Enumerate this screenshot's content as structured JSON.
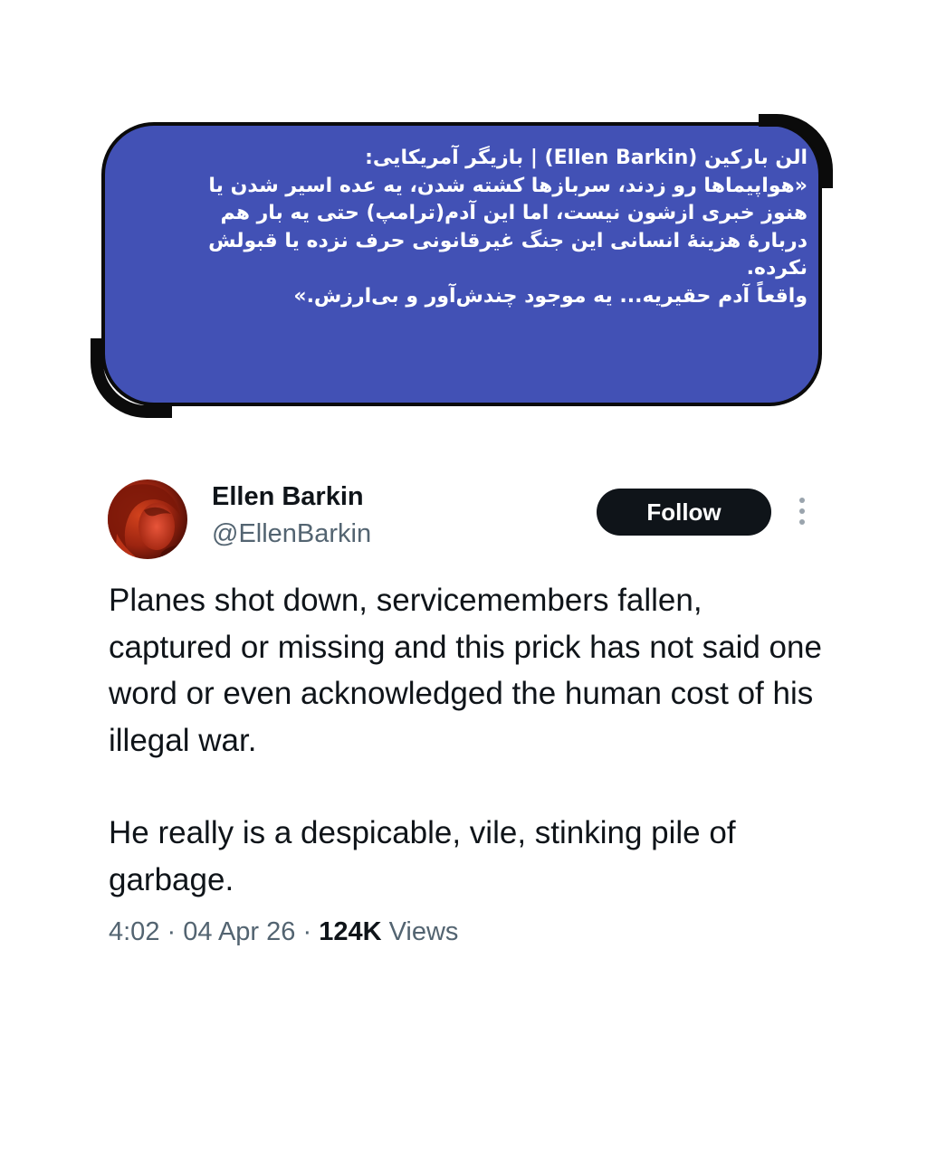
{
  "translation_card": {
    "line1": "الن بارکین (Ellen Barkin) | بازیگر آمریکایی:",
    "line2": "«هواپیماها رو زدند، سربازها کشته شدن، یه عده اسیر شدن یا",
    "line3": "هنوز خبری ازشون نیست، اما این آدم(ترامپ) حتی یه بار هم",
    "line4": "دربارهٔ هزینهٔ انسانی این جنگ غیرقانونی حرف نزده یا قبولش",
    "line5": "نکرده.",
    "line6": "واقعاً آدم حقیریه... یه موجود چندش‌آور و بی‌ارزش.»",
    "background_color": "#4251b5"
  },
  "tweet": {
    "display_name": "Ellen Barkin",
    "handle": "@EllenBarkin",
    "follow_label": "Follow",
    "more_icon": "more-vertical-icon",
    "paragraph1": "Planes shot down, servicemembers fallen, captured or missing and this prick has not said one word or even acknowledged the human cost of his illegal war.",
    "paragraph2": "He really is a despicable, vile, stinking pile of garbage.",
    "time": "4:02",
    "date": "04 Apr 26",
    "views_count": "124K",
    "views_label": "Views",
    "separator": "·"
  }
}
